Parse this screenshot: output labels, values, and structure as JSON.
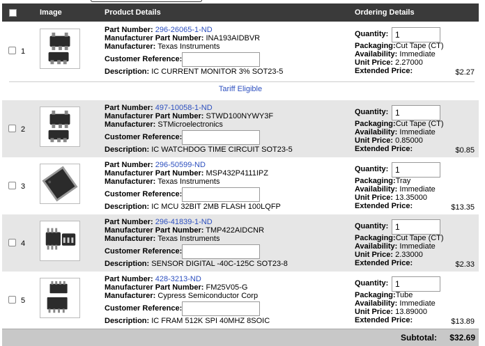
{
  "header": {
    "image": "Image",
    "details": "Product Details",
    "ordering": "Ordering Details"
  },
  "labels": {
    "part_number": "Part Number:",
    "mfr_part_number": "Manufacturer Part Number:",
    "manufacturer": "Manufacturer:",
    "customer_reference": "Customer Reference:",
    "description": "Description:",
    "quantity": "Quantity:",
    "packaging": "Packaging:",
    "availability": "Availability:",
    "unit_price": "Unit Price:",
    "extended_price": "Extended Price:"
  },
  "tariff_link": "Tariff Eligible",
  "rows": [
    {
      "index": "1",
      "part_number": "296-26065-1-ND",
      "mfr_part_number": "INA193AIDBVR",
      "manufacturer": "Texas Instruments",
      "description": "IC CURRENT MONITOR 3% SOT23-5",
      "quantity": "1",
      "packaging": "Cut Tape (CT)",
      "availability": "Immediate",
      "unit_price": "2.27000",
      "extended_price": "$2.27",
      "image_icon": "sot23-5-package-icon"
    },
    {
      "index": "2",
      "part_number": "497-10058-1-ND",
      "mfr_part_number": "STWD100NYWY3F",
      "manufacturer": "STMicroelectronics",
      "description": "IC WATCHDOG TIME CIRCUIT SOT23-5",
      "quantity": "1",
      "packaging": "Cut Tape (CT)",
      "availability": "Immediate",
      "unit_price": "0.85000",
      "extended_price": "$0.85",
      "image_icon": "sot23-5-package-icon"
    },
    {
      "index": "3",
      "part_number": "296-50599-ND",
      "mfr_part_number": "MSP432P4111IPZ",
      "manufacturer": "Texas Instruments",
      "description": "IC MCU 32BIT 2MB FLASH 100LQFP",
      "quantity": "1",
      "packaging": "Tray",
      "availability": "Immediate",
      "unit_price": "13.35000",
      "extended_price": "$13.35",
      "image_icon": "lqfp-package-icon"
    },
    {
      "index": "4",
      "part_number": "296-41839-1-ND",
      "mfr_part_number": "TMP422AIDCNR",
      "manufacturer": "Texas Instruments",
      "description": "SENSOR DIGITAL -40C-125C SOT23-8",
      "quantity": "1",
      "packaging": "Cut Tape (CT)",
      "availability": "Immediate",
      "unit_price": "2.33000",
      "extended_price": "$2.33",
      "image_icon": "sot23-8-package-icon"
    },
    {
      "index": "5",
      "part_number": "428-3213-ND",
      "mfr_part_number": "FM25V05-G",
      "manufacturer": "Cypress Semiconductor Corp",
      "description": "IC FRAM 512K SPI 40MHZ 8SOIC",
      "quantity": "1",
      "packaging": "Tube",
      "availability": "Immediate",
      "unit_price": "13.89000",
      "extended_price": "$13.89",
      "image_icon": "soic-8-package-icon"
    }
  ],
  "subtotal": {
    "label": "Subtotal:",
    "value": "$32.69"
  }
}
